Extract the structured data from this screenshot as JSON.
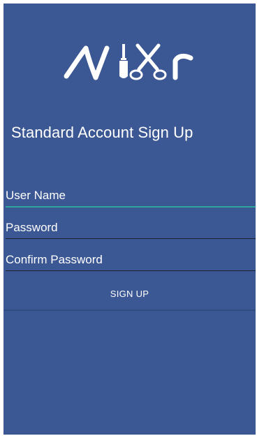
{
  "app": {
    "logo_text": "NiXr"
  },
  "signup": {
    "title": "Standard Account Sign Up",
    "username_placeholder": "User Name",
    "password_placeholder": "Password",
    "confirm_password_placeholder": "Confirm Password",
    "submit_label": "SIGN UP"
  },
  "colors": {
    "background": "#3b5894",
    "text": "#ffffff",
    "focused_underline": "#2ea89a",
    "underline": "#1c2233"
  }
}
